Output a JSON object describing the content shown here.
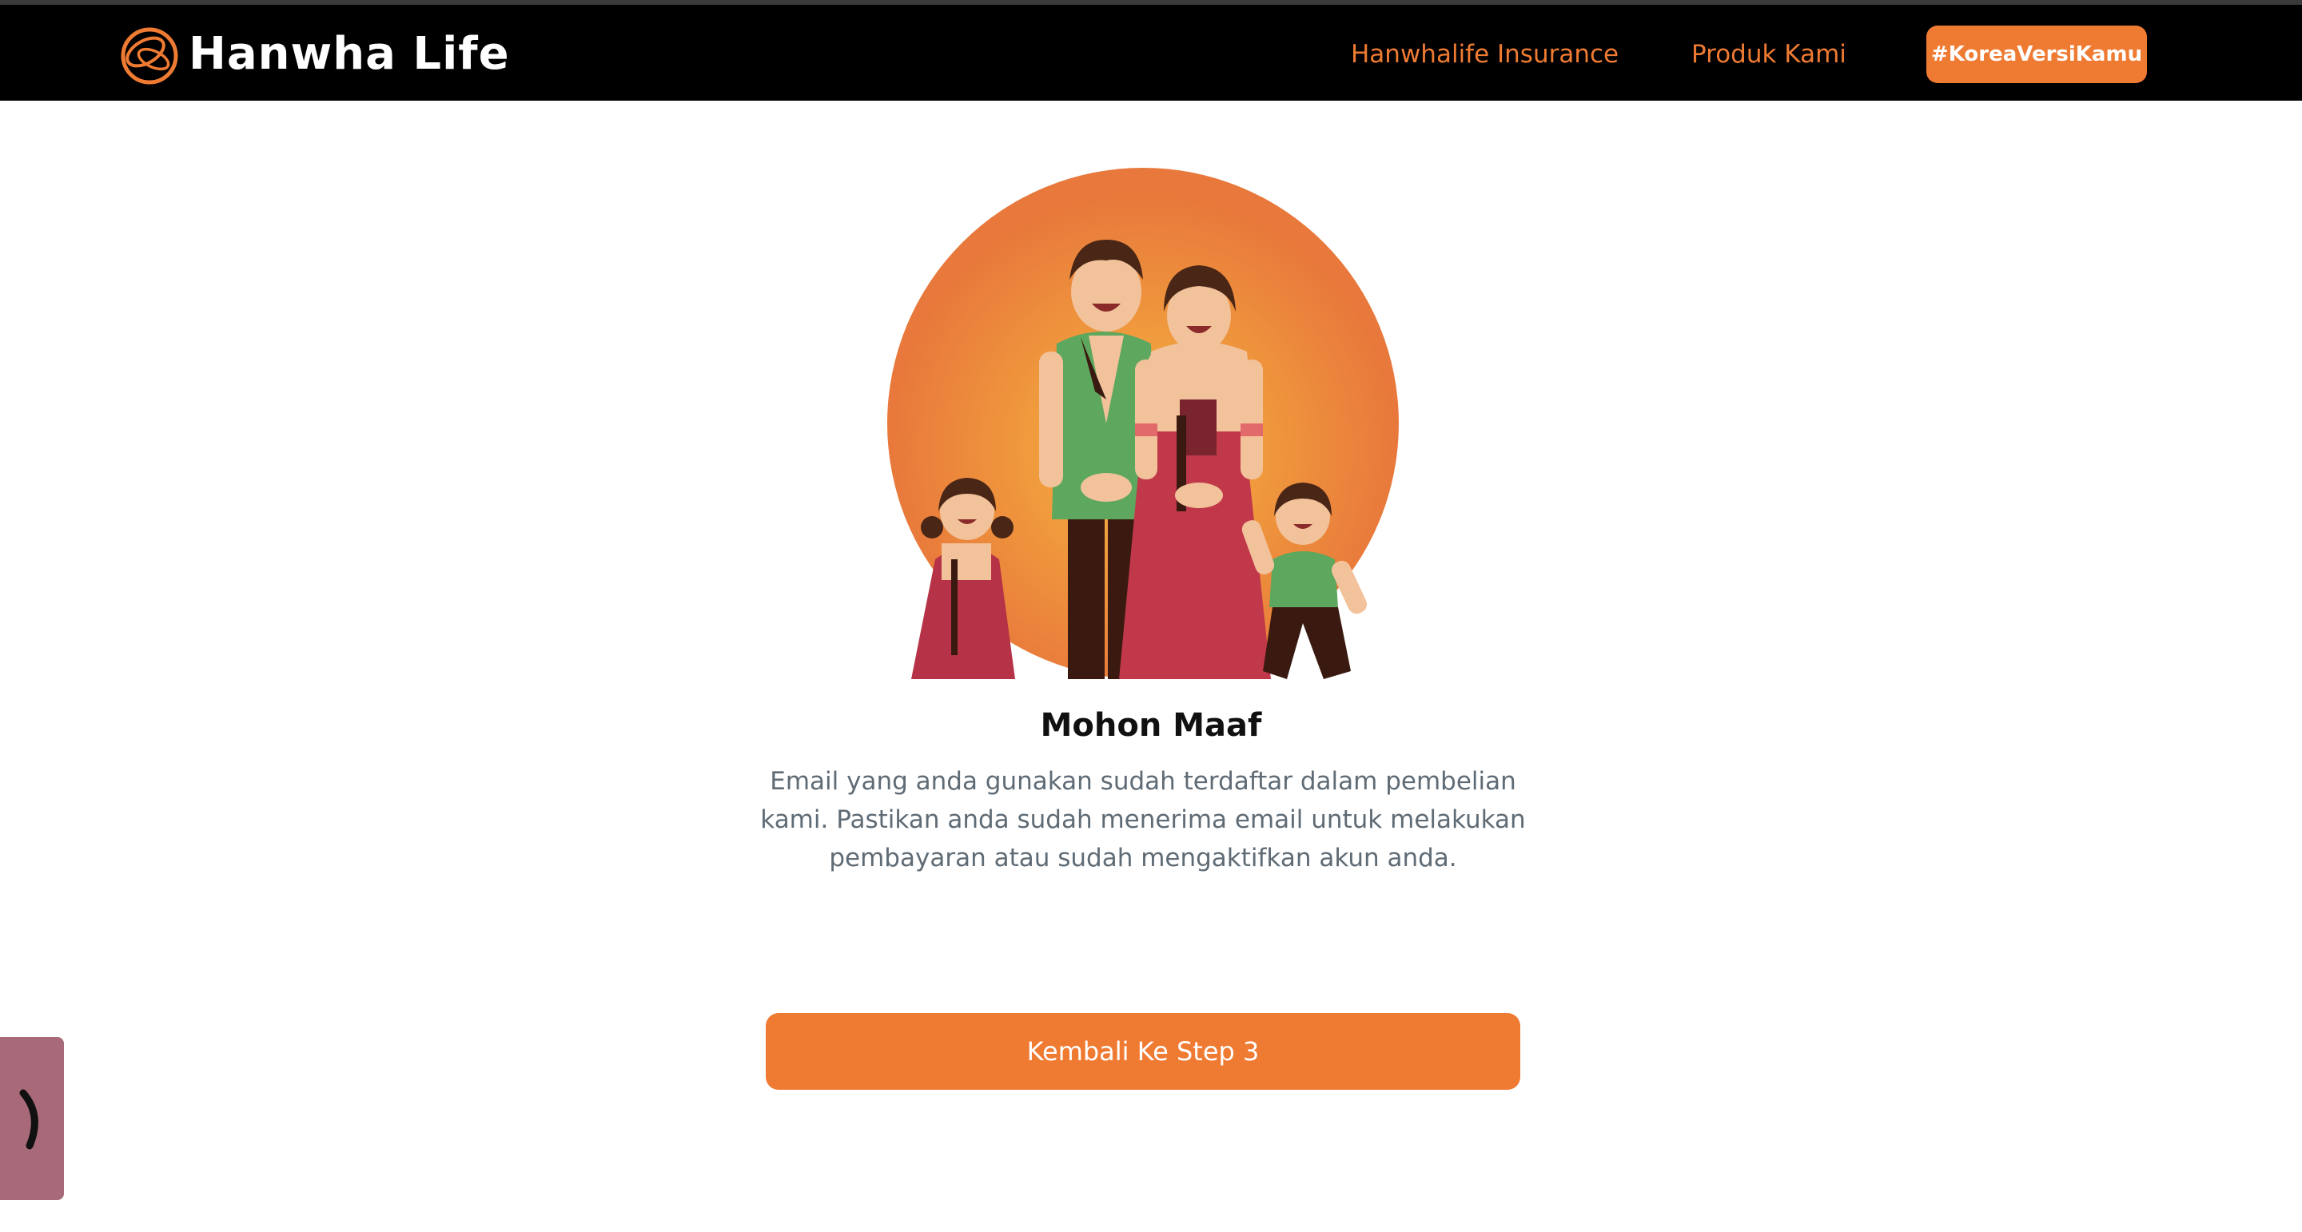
{
  "header": {
    "logo_text": "Hanwha Life",
    "nav_links": [
      {
        "label": "Hanwhalife Insurance"
      },
      {
        "label": "Produk Kami"
      }
    ],
    "cta_label": "#KoreaVersiKamu"
  },
  "main": {
    "title": "Mohon Maaf",
    "message": "Email yang anda gunakan sudah terdaftar dalam pembelian kami. Pastikan anda sudah menerima email untuk melakukan pembayaran atau sudah mengaktifkan akun anda.",
    "back_button_label": "Kembali Ke Step 3"
  },
  "side_tab": {
    "icon": "chevron-right-icon"
  },
  "colors": {
    "accent": "#ef7b33",
    "navbar": "#000000",
    "text_muted": "#5f6b75",
    "side_tab": "#a86a78"
  }
}
